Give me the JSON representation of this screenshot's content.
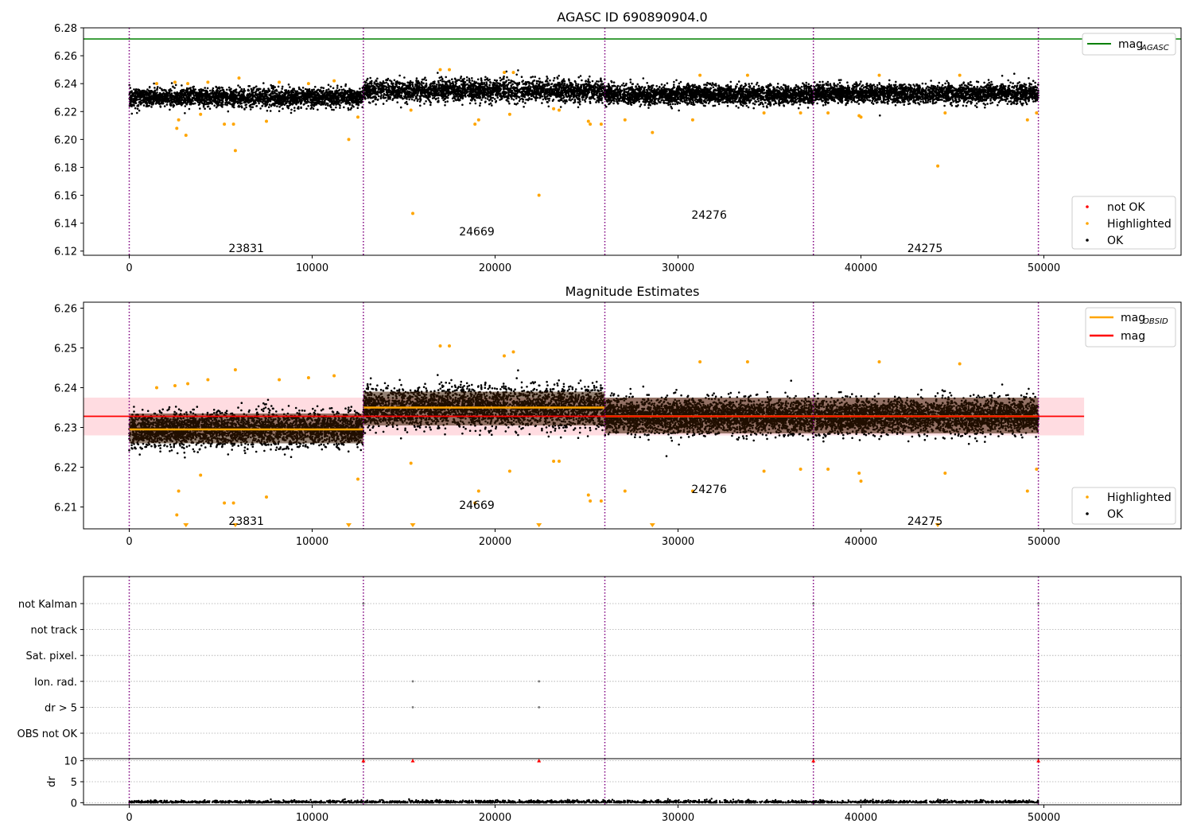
{
  "chart_data": [
    {
      "type": "scatter",
      "title": "AGASC ID 690890904.0",
      "xlim": [
        -2500,
        57500
      ],
      "ylim": [
        6.117,
        6.28
      ],
      "x_ticks": [
        0,
        10000,
        20000,
        30000,
        40000,
        50000
      ],
      "y_ticks": [
        6.12,
        6.14,
        6.16,
        6.18,
        6.2,
        6.22,
        6.24,
        6.26,
        6.28
      ],
      "y_tick_labels": [
        "6.12",
        "6.14",
        "6.16",
        "6.18",
        "6.20",
        "6.22",
        "6.24",
        "6.26",
        "6.28"
      ],
      "obs_boundaries": [
        0,
        12800,
        26000,
        37400,
        49700
      ],
      "obs_labels": [
        {
          "x": 6400,
          "y": 6.122,
          "text": "23831"
        },
        {
          "x": 19000,
          "y": 6.134,
          "text": "24669"
        },
        {
          "x": 31700,
          "y": 6.146,
          "text": "24276"
        },
        {
          "x": 43500,
          "y": 6.122,
          "text": "24275"
        }
      ],
      "mag_agasc": 6.272,
      "segments": [
        {
          "x0": 0,
          "x1": 12800,
          "center": 6.23,
          "spread": 0.006
        },
        {
          "x0": 12800,
          "x1": 26000,
          "center": 6.235,
          "spread": 0.007
        },
        {
          "x0": 26000,
          "x1": 37400,
          "center": 6.232,
          "spread": 0.006
        },
        {
          "x0": 37400,
          "x1": 49700,
          "center": 6.233,
          "spread": 0.006
        }
      ],
      "highlighted": [
        [
          2600,
          6.208
        ],
        [
          2700,
          6.214
        ],
        [
          3100,
          6.203
        ],
        [
          3900,
          6.218
        ],
        [
          5200,
          6.211
        ],
        [
          5700,
          6.211
        ],
        [
          5800,
          6.192
        ],
        [
          7500,
          6.213
        ],
        [
          12000,
          6.2
        ],
        [
          12500,
          6.216
        ],
        [
          1500,
          6.24
        ],
        [
          2500,
          6.241
        ],
        [
          3200,
          6.24
        ],
        [
          4300,
          6.241
        ],
        [
          6000,
          6.244
        ],
        [
          8200,
          6.241
        ],
        [
          9800,
          6.24
        ],
        [
          11200,
          6.242
        ],
        [
          15400,
          6.221
        ],
        [
          15500,
          6.147
        ],
        [
          17000,
          6.25
        ],
        [
          17500,
          6.25
        ],
        [
          18900,
          6.211
        ],
        [
          19100,
          6.214
        ],
        [
          20800,
          6.218
        ],
        [
          20500,
          6.248
        ],
        [
          21000,
          6.248
        ],
        [
          22400,
          6.16
        ],
        [
          23200,
          6.222
        ],
        [
          23500,
          6.221
        ],
        [
          25100,
          6.213
        ],
        [
          25200,
          6.211
        ],
        [
          25800,
          6.211
        ],
        [
          27100,
          6.214
        ],
        [
          28600,
          6.205
        ],
        [
          30800,
          6.214
        ],
        [
          31200,
          6.246
        ],
        [
          34700,
          6.219
        ],
        [
          33800,
          6.246
        ],
        [
          36700,
          6.219
        ],
        [
          38200,
          6.219
        ],
        [
          39900,
          6.217
        ],
        [
          40000,
          6.216
        ],
        [
          41000,
          6.246
        ],
        [
          44200,
          6.181
        ],
        [
          44600,
          6.219
        ],
        [
          45400,
          6.246
        ],
        [
          49100,
          6.214
        ],
        [
          49600,
          6.219
        ]
      ],
      "legend": {
        "lines": [
          {
            "label": "mag",
            "sub": "AGASC",
            "color": "#008000"
          }
        ],
        "points": [
          {
            "label": "not OK",
            "color": "#ff0000"
          },
          {
            "label": "Highlighted",
            "color": "#ffa500"
          },
          {
            "label": "OK",
            "color": "#000000"
          }
        ]
      }
    },
    {
      "type": "scatter",
      "title": "Magnitude Estimates",
      "xlim": [
        -2500,
        57500
      ],
      "ylim": [
        6.2045,
        6.2615
      ],
      "x_ticks": [
        0,
        10000,
        20000,
        30000,
        40000,
        50000
      ],
      "y_ticks": [
        6.21,
        6.22,
        6.23,
        6.24,
        6.25,
        6.26
      ],
      "y_tick_labels": [
        "6.21",
        "6.22",
        "6.23",
        "6.24",
        "6.25",
        "6.26"
      ],
      "obs_boundaries": [
        0,
        12800,
        26000,
        37400,
        49700
      ],
      "obs_labels": [
        {
          "x": 6400,
          "y": 6.2065,
          "text": "23831"
        },
        {
          "x": 19000,
          "y": 6.2105,
          "text": "24669"
        },
        {
          "x": 31700,
          "y": 6.2145,
          "text": "24276"
        },
        {
          "x": 43500,
          "y": 6.2065,
          "text": "24275"
        }
      ],
      "mag_line": 6.2328,
      "mag_band": [
        6.228,
        6.2375
      ],
      "mag_band_x": [
        -2500,
        52200
      ],
      "segments": [
        {
          "x0": 0,
          "x1": 12800,
          "center": 6.2295,
          "spread": 0.0038,
          "band": [
            6.226,
            6.2335
          ]
        },
        {
          "x0": 12800,
          "x1": 26000,
          "center": 6.235,
          "spread": 0.0045,
          "band": [
            6.2305,
            6.239
          ]
        },
        {
          "x0": 26000,
          "x1": 37400,
          "center": 6.2328,
          "spread": 0.0038,
          "band": [
            6.2285,
            6.2375
          ]
        },
        {
          "x0": 37400,
          "x1": 49700,
          "center": 6.2328,
          "spread": 0.0038,
          "band": [
            6.2285,
            6.2375
          ]
        }
      ],
      "highlighted": [
        [
          2600,
          6.208
        ],
        [
          2700,
          6.214
        ],
        [
          3900,
          6.218
        ],
        [
          5200,
          6.211
        ],
        [
          5700,
          6.211
        ],
        [
          5800,
          6.2445
        ],
        [
          7500,
          6.2125
        ],
        [
          12500,
          6.217
        ],
        [
          1500,
          6.24
        ],
        [
          2500,
          6.2405
        ],
        [
          3200,
          6.241
        ],
        [
          4300,
          6.242
        ],
        [
          8200,
          6.242
        ],
        [
          9800,
          6.2425
        ],
        [
          11200,
          6.243
        ],
        [
          15400,
          6.221
        ],
        [
          17000,
          6.2505
        ],
        [
          17500,
          6.2505
        ],
        [
          18900,
          6.211
        ],
        [
          19100,
          6.214
        ],
        [
          20800,
          6.219
        ],
        [
          20500,
          6.248
        ],
        [
          21000,
          6.249
        ],
        [
          23200,
          6.2215
        ],
        [
          23500,
          6.2215
        ],
        [
          25100,
          6.213
        ],
        [
          25200,
          6.2115
        ],
        [
          25800,
          6.2115
        ],
        [
          27100,
          6.214
        ],
        [
          30800,
          6.214
        ],
        [
          31200,
          6.2465
        ],
        [
          34700,
          6.219
        ],
        [
          33800,
          6.2465
        ],
        [
          36700,
          6.2195
        ],
        [
          38200,
          6.2195
        ],
        [
          39900,
          6.2185
        ],
        [
          40000,
          6.2165
        ],
        [
          41000,
          6.2465
        ],
        [
          44600,
          6.2185
        ],
        [
          45400,
          6.246
        ],
        [
          49100,
          6.214
        ],
        [
          49600,
          6.2195
        ]
      ],
      "below_markers_x": [
        3100,
        5800,
        12000,
        15500,
        22400,
        28600,
        44200
      ],
      "legend": {
        "lines": [
          {
            "label": "mag",
            "sub": "OBSID",
            "color": "#ffa500"
          },
          {
            "label": "mag",
            "sub": "",
            "color": "#ff0000"
          }
        ],
        "points": [
          {
            "label": "Highlighted",
            "color": "#ffa500"
          },
          {
            "label": "OK",
            "color": "#000000"
          }
        ]
      }
    },
    {
      "type": "scatter",
      "title": "",
      "xlim": [
        -2500,
        57500
      ],
      "x_ticks": [
        0,
        10000,
        20000,
        30000,
        40000,
        50000
      ],
      "flag_rows": [
        "not Kalman",
        "not track",
        "Sat. pixel.",
        "Ion. rad.",
        "dr > 5",
        "OBS not OK"
      ],
      "flag_points": [
        {
          "row": "not Kalman",
          "x": [
            12800,
            37400,
            49700
          ]
        },
        {
          "row": "Ion. rad.",
          "x": [
            15500,
            22400
          ]
        },
        {
          "row": "dr > 5",
          "x": [
            15500,
            22400
          ]
        }
      ],
      "obs_boundaries": [
        0,
        12800,
        26000,
        37400,
        49700
      ],
      "dr": {
        "ylabel": "dr",
        "ylim": [
          -0.5,
          10.5
        ],
        "y_ticks": [
          0,
          5,
          10
        ],
        "y_tick_labels": [
          "0",
          "5",
          "10"
        ],
        "outliers": [
          [
            12800,
            10
          ],
          [
            15500,
            10
          ],
          [
            22400,
            10
          ],
          [
            37400,
            10
          ],
          [
            49700,
            10
          ]
        ]
      }
    }
  ],
  "colors": {
    "ok": "#000000",
    "highlighted": "#ffa500",
    "not_ok": "#ff0000",
    "agasc": "#008000",
    "boundary": "#800080",
    "band": "#ffc0c8"
  }
}
